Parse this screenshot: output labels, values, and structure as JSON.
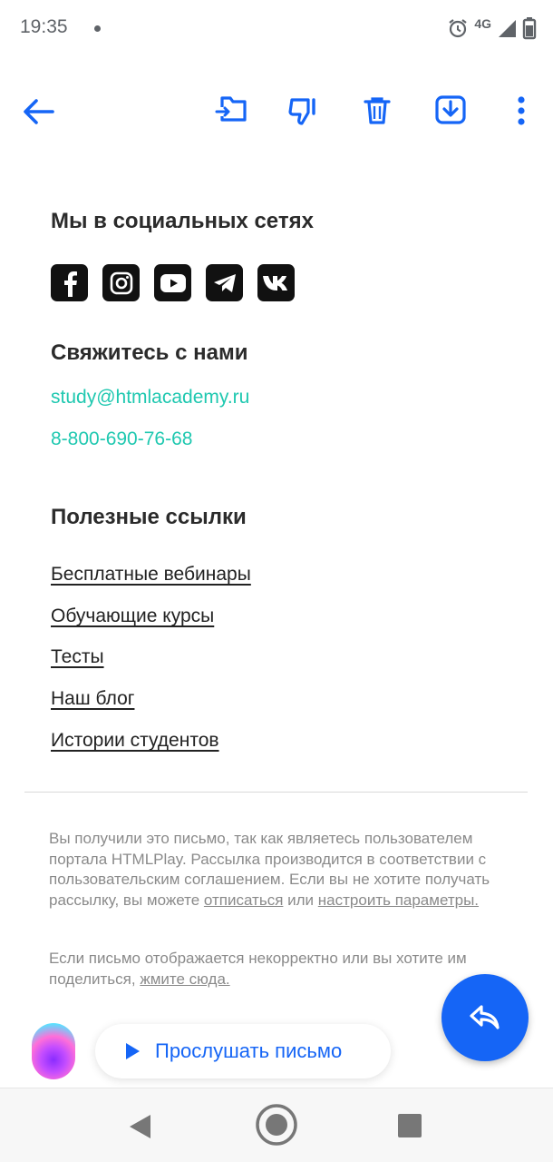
{
  "status_bar": {
    "time": "19:35",
    "network": "4G",
    "icons": [
      "notification-dot-icon",
      "alarm-icon",
      "signal-icon",
      "battery-icon"
    ]
  },
  "toolbar": {
    "icons": [
      "back-arrow-icon",
      "move-to-folder-icon",
      "thumbs-down-icon",
      "trash-icon",
      "download-icon",
      "more-vert-icon"
    ],
    "accent": "#1565f6"
  },
  "social": {
    "title": "Мы в социальных сетях",
    "networks": [
      "facebook",
      "instagram",
      "youtube",
      "telegram",
      "vk"
    ]
  },
  "contact": {
    "title": "Свяжитесь с нами",
    "email": "study@htmlacademy.ru",
    "phone": "8-800-690-76-68",
    "link_color": "#1fc8b0"
  },
  "links": {
    "title": "Полезные ссылки",
    "items": [
      "Бесплатные вебинары",
      "Обучающие курсы",
      "Тесты",
      "Наш блог",
      "Истории студентов"
    ]
  },
  "footer": {
    "p1_text": "Вы получили это письмо, так как являетесь пользователем портала HTMLPlay. Рассылка производится в соответствии с пользовательским соглашением. Если вы не хотите получать рассылку, вы можете",
    "unsubscribe": "отписаться",
    "or": "или",
    "settings": "настроить параметры.",
    "p2_text": "Если письмо отображается некорректно или вы хотите им поделиться,",
    "click_here": "жмите сюда."
  },
  "actions": {
    "listen_label": "Прослушать письмо",
    "fab_icon": "reply-icon"
  },
  "nav_bar": {
    "icons": [
      "back-triangle-icon",
      "home-circle-icon",
      "recents-square-icon"
    ]
  }
}
